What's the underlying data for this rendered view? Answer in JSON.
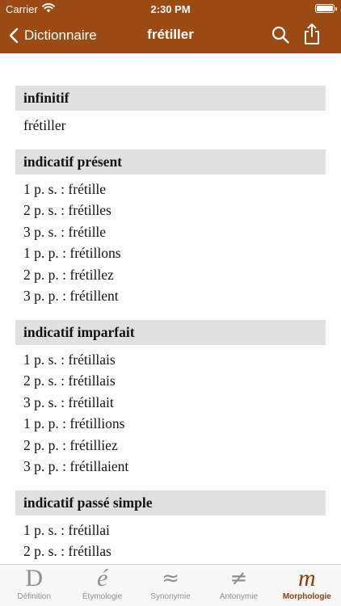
{
  "status_bar": {
    "carrier": "Carrier",
    "time": "2:30 PM"
  },
  "nav": {
    "back_label": "Dictionnaire",
    "title": "frétiller"
  },
  "sections": [
    {
      "title": "infinitif",
      "rows": [
        "frétiller"
      ]
    },
    {
      "title": "indicatif présent",
      "rows": [
        "1 p. s. : frétille",
        "2 p. s. : frétilles",
        "3 p. s. : frétille",
        "1 p. p. : frétillons",
        "2 p. p. : frétillez",
        "3 p. p. : frétillent"
      ]
    },
    {
      "title": "indicatif imparfait",
      "rows": [
        "1 p. s. : frétillais",
        "2 p. s. : frétillais",
        "3 p. s. : frétillait",
        "1 p. p. : frétillions",
        "2 p. p. : frétilliez",
        "3 p. p. : frétillaient"
      ]
    },
    {
      "title": "indicatif passé simple",
      "rows": [
        "1 p. s. : frétillai",
        "2 p. s. : frétillas"
      ]
    }
  ],
  "tabs": [
    {
      "glyph": "D",
      "label": "Définition",
      "icon": "definition-icon"
    },
    {
      "glyph": "é",
      "label": "Étymologie",
      "icon": "etymology-icon"
    },
    {
      "glyph": "≈",
      "label": "Synonymie",
      "icon": "synonym-icon"
    },
    {
      "glyph": "≠",
      "label": "Antonymie",
      "icon": "antonym-icon"
    },
    {
      "glyph": "m",
      "label": "Morphologie",
      "icon": "morphology-icon",
      "active": true
    }
  ],
  "colors": {
    "header": "#9b4a14",
    "tab_active": "#8a3f10",
    "tab_inactive": "#8e8e93",
    "section_bg": "#e0e0e0"
  }
}
